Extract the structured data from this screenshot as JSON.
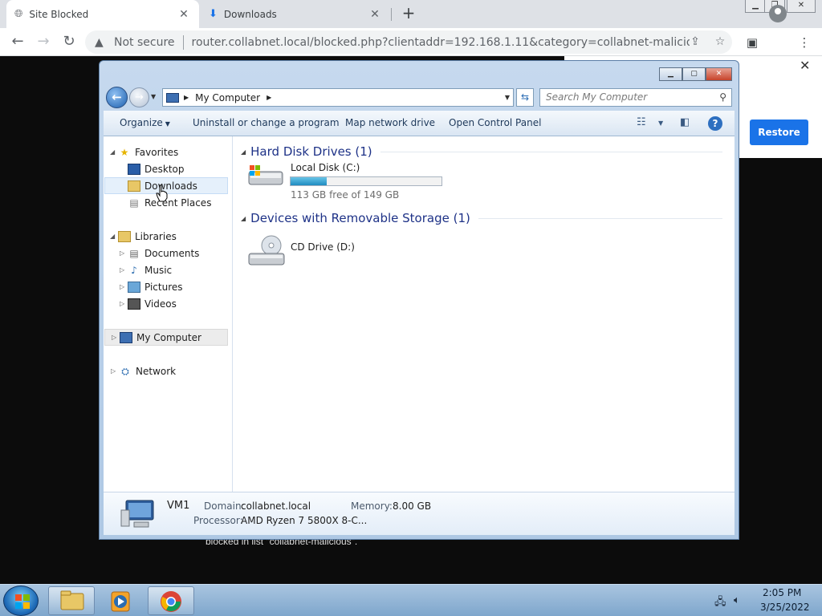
{
  "browser": {
    "tabs": [
      {
        "title": "Site Blocked",
        "icon": "globe-icon",
        "close": "✕"
      },
      {
        "title": "Downloads",
        "icon": "download-icon",
        "close": "✕"
      }
    ],
    "new_tab": "+",
    "security_label": "Not secure",
    "url": "router.collabnet.local/blocked.php?clientaddr=192.168.1.11&category=collabnet-malicious&url=io..."
  },
  "page": {
    "blocked_text": "blocked in list \"collabnet-malicious\".",
    "restore_label": "Restore",
    "close_glyph": "✕"
  },
  "explorer": {
    "address_crumb": "My Computer",
    "search_placeholder": "Search My Computer",
    "commands": {
      "organize": "Organize",
      "uninstall": "Uninstall or change a program",
      "map_drive": "Map network drive",
      "control_panel": "Open Control Panel"
    },
    "nav": {
      "favorites": "Favorites",
      "desktop": "Desktop",
      "downloads": "Downloads",
      "recent_places": "Recent Places",
      "libraries": "Libraries",
      "documents": "Documents",
      "music": "Music",
      "pictures": "Pictures",
      "videos": "Videos",
      "my_computer": "My Computer",
      "network": "Network"
    },
    "groups": {
      "hdd": "Hard Disk Drives (1)",
      "removable": "Devices with Removable Storage (1)"
    },
    "drives": {
      "c_name": "Local Disk (C:)",
      "c_free": "113 GB free of 149 GB",
      "c_used_fraction": 0.24,
      "d_name": "CD Drive (D:)"
    },
    "details": {
      "name": "VM1",
      "domain_label": "Domain:",
      "domain_value": "collabnet.local",
      "memory_label": "Memory:",
      "memory_value": "8.00 GB",
      "processor_label": "Processor:",
      "processor_value": "AMD Ryzen 7 5800X 8-C..."
    }
  },
  "taskbar": {
    "time": "2:05 PM",
    "date": "3/25/2022"
  }
}
